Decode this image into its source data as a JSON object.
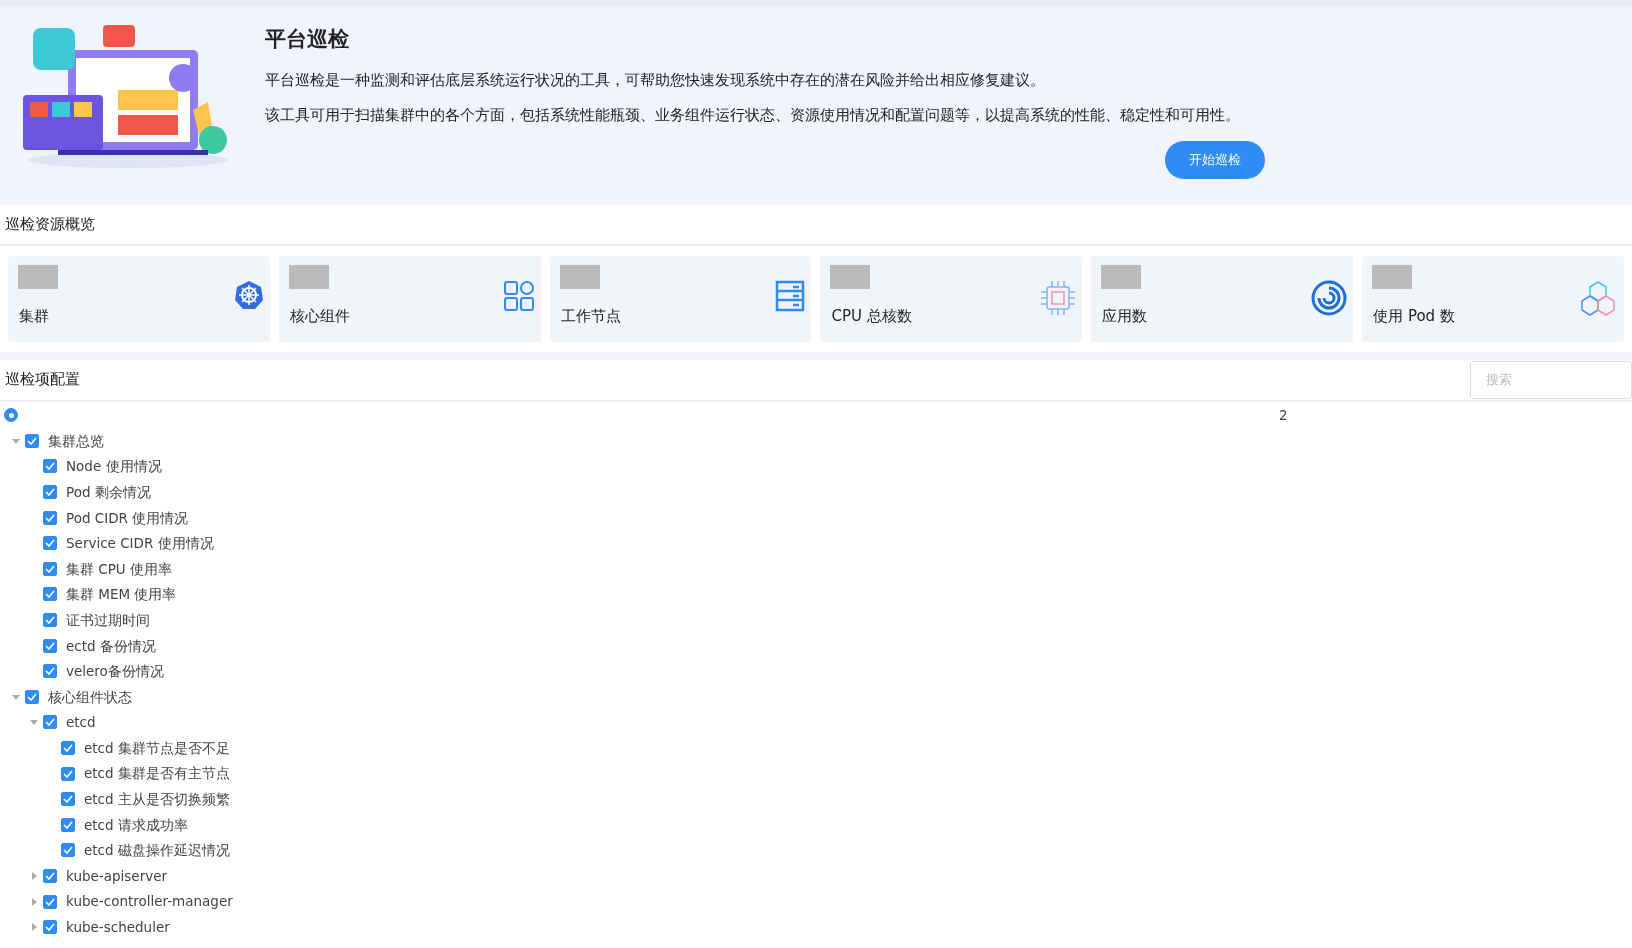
{
  "banner": {
    "title": "平台巡检",
    "paragraphs": [
      "平台巡检是一种监测和评估底层系统运行状况的工具，可帮助您快速发现系统中存在的潜在风险并给出相应修复建议。",
      "该工具可用于扫描集群中的各个方面，包括系统性能瓶颈、业务组件运行状态、资源使用情况和配置问题等，以提高系统的性能、稳定性和可用性。"
    ],
    "button": "开始巡检"
  },
  "overview": {
    "title": "巡检资源概览",
    "cards": [
      {
        "label": "集群"
      },
      {
        "label": "核心组件"
      },
      {
        "label": "工作节点"
      },
      {
        "label": "CPU 总核数"
      },
      {
        "label": "应用数"
      },
      {
        "label": "使用 Pod 数"
      }
    ]
  },
  "config": {
    "title": "巡检项配置",
    "search": {
      "placeholder": "搜索"
    },
    "root": {
      "selected": true,
      "count": "2"
    },
    "tree": [
      {
        "label": "集群总览",
        "checked": true,
        "expanded": true,
        "children": [
          {
            "label": "Node 使用情况",
            "checked": true
          },
          {
            "label": "Pod 剩余情况",
            "checked": true
          },
          {
            "label": "Pod CIDR 使用情况",
            "checked": true
          },
          {
            "label": "Service CIDR 使用情况",
            "checked": true
          },
          {
            "label": "集群 CPU 使用率",
            "checked": true
          },
          {
            "label": "集群 MEM 使用率",
            "checked": true
          },
          {
            "label": "证书过期时间",
            "checked": true
          },
          {
            "label": "ectd 备份情况",
            "checked": true
          },
          {
            "label": "velero备份情况",
            "checked": true
          }
        ]
      },
      {
        "label": "核心组件状态",
        "checked": true,
        "expanded": true,
        "children": [
          {
            "label": "etcd",
            "checked": true,
            "expanded": true,
            "children": [
              {
                "label": "etcd 集群节点是否不足",
                "checked": true
              },
              {
                "label": "etcd 集群是否有主节点",
                "checked": true
              },
              {
                "label": "etcd 主从是否切换频繁",
                "checked": true
              },
              {
                "label": "etcd 请求成功率",
                "checked": true
              },
              {
                "label": "etcd 磁盘操作延迟情况",
                "checked": true
              }
            ]
          },
          {
            "label": "kube-apiserver",
            "checked": true,
            "expanded": false
          },
          {
            "label": "kube-controller-manager",
            "checked": true,
            "expanded": false
          },
          {
            "label": "kube-scheduler",
            "checked": true,
            "expanded": false
          }
        ]
      }
    ]
  }
}
